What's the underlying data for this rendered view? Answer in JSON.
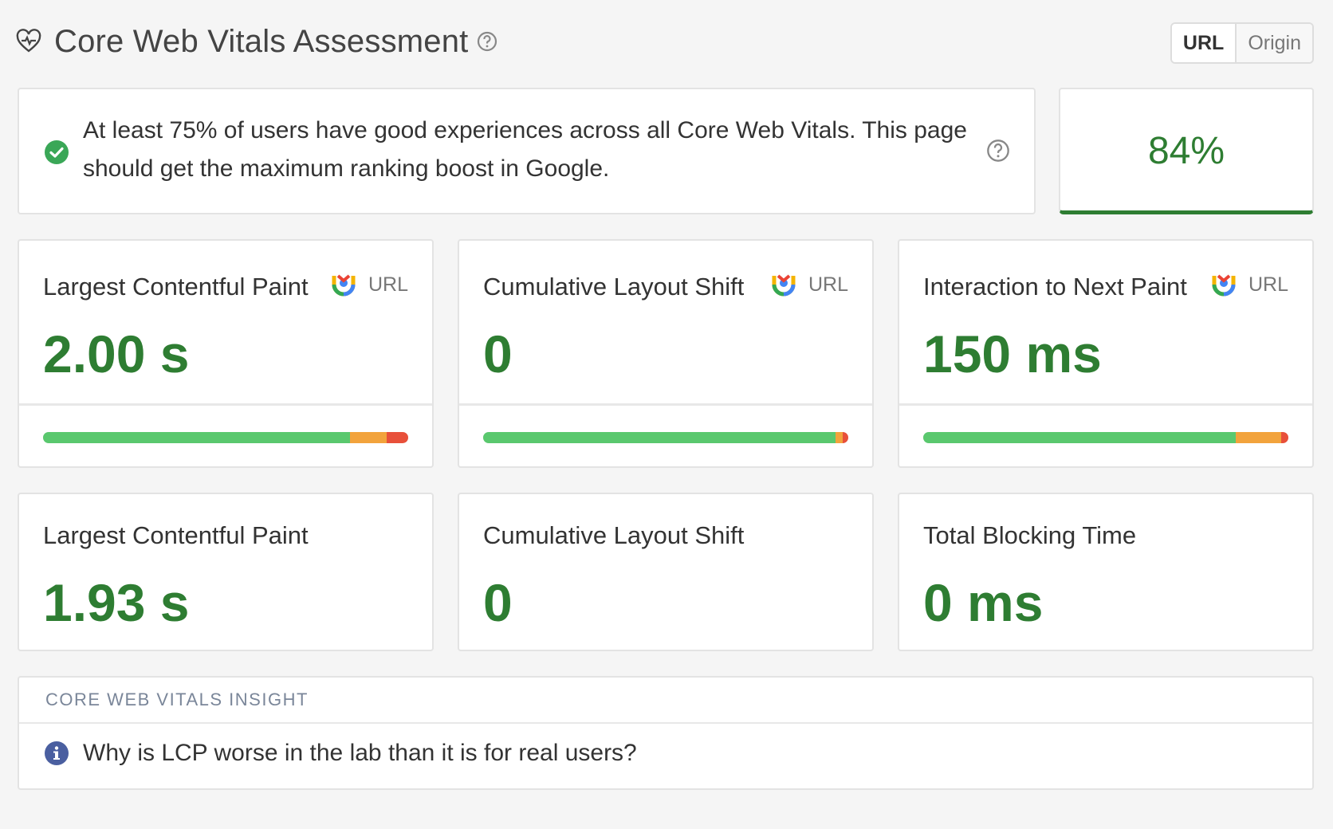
{
  "header": {
    "title": "Core Web Vitals Assessment",
    "icons": {
      "heart": "heart-pulse-icon",
      "help": "help-circle-icon"
    },
    "toggle": {
      "options": [
        "URL",
        "Origin"
      ],
      "selected": "URL"
    }
  },
  "assessment": {
    "message": "At least 75% of users have good experiences across all Core Web Vitals. This page should get the maximum ranking boost in Google.",
    "status": "pass",
    "score": "84%"
  },
  "field_metrics": [
    {
      "title": "Largest Contentful Paint",
      "tag": "URL",
      "value": "2.00 s",
      "distribution": {
        "good": 0.84,
        "needs_improvement": 0.1,
        "poor": 0.06
      }
    },
    {
      "title": "Cumulative Layout Shift",
      "tag": "URL",
      "value": "0",
      "distribution": {
        "good": 0.965,
        "needs_improvement": 0.02,
        "poor": 0.015
      }
    },
    {
      "title": "Interaction to Next Paint",
      "tag": "URL",
      "value": "150 ms",
      "distribution": {
        "good": 0.855,
        "needs_improvement": 0.125,
        "poor": 0.02
      }
    }
  ],
  "lab_metrics": [
    {
      "title": "Largest Contentful Paint",
      "value": "1.93 s"
    },
    {
      "title": "Cumulative Layout Shift",
      "value": "0"
    },
    {
      "title": "Total Blocking Time",
      "value": "0 ms"
    }
  ],
  "insight": {
    "heading": "CORE WEB VITALS INSIGHT",
    "question": "Why is LCP worse in the lab than it is for real users?"
  },
  "colors": {
    "good": "#5ac86e",
    "needs_improvement": "#f2a33c",
    "poor": "#e8503a",
    "value_green": "#2e7d32",
    "info_blue": "#4a5fa0"
  }
}
